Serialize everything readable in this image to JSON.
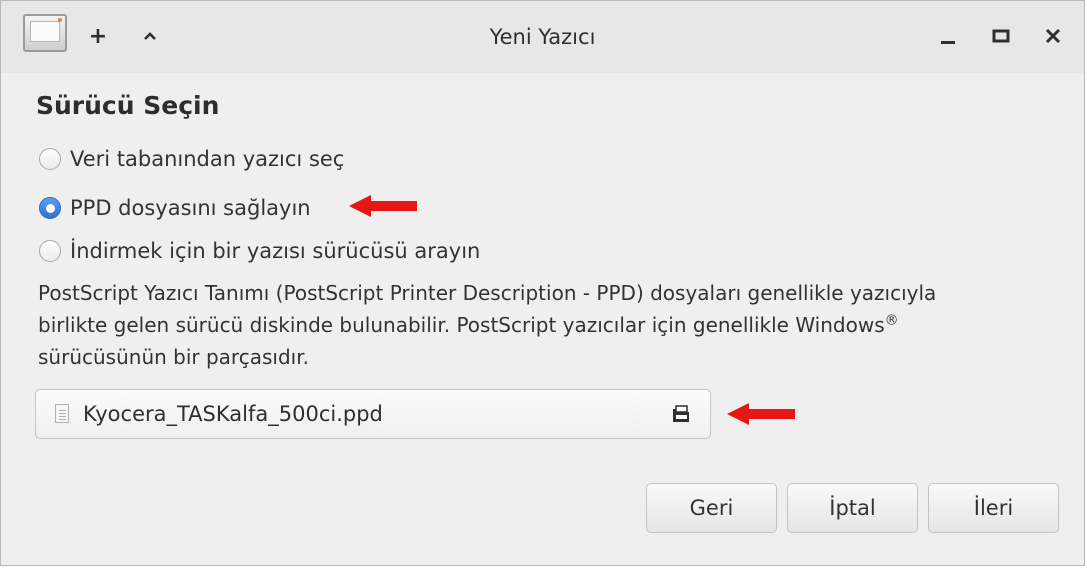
{
  "window": {
    "title": "Yeni Yazıcı",
    "buttons": {
      "add": "+",
      "up": "^",
      "minimize": "_",
      "maximize": "□",
      "close": "✕"
    }
  },
  "page": {
    "heading": "Sürücü Seçin",
    "options": [
      {
        "label": "Veri tabanından yazıcı seç",
        "selected": false
      },
      {
        "label": "PPD dosyasını sağlayın",
        "selected": true
      },
      {
        "label": "İndirmek için bir yazısı sürücüsü arayın",
        "selected": false
      }
    ],
    "description_line1": "PostScript Yazıcı Tanımı (PostScript Printer Description - PPD) dosyaları genellikle yazıcıyla",
    "description_line2": "birlikte gelen sürücü diskinde bulunabilir. PostScript yazıcılar için genellikle Windows",
    "description_trademark": "®",
    "description_line3": "sürücüsünün bir parçasıdır.",
    "file_chooser": {
      "value": "Kyocera_TASKalfa_500ci.ppd",
      "icon": "document-icon",
      "open_icon": "open-folder-icon"
    }
  },
  "footer": {
    "back_label": "Geri",
    "cancel_label": "İptal",
    "next_label": "İleri"
  },
  "annotations": {
    "arrow_color": "#e41616"
  },
  "colors": {
    "accent": "#2d73d1"
  }
}
